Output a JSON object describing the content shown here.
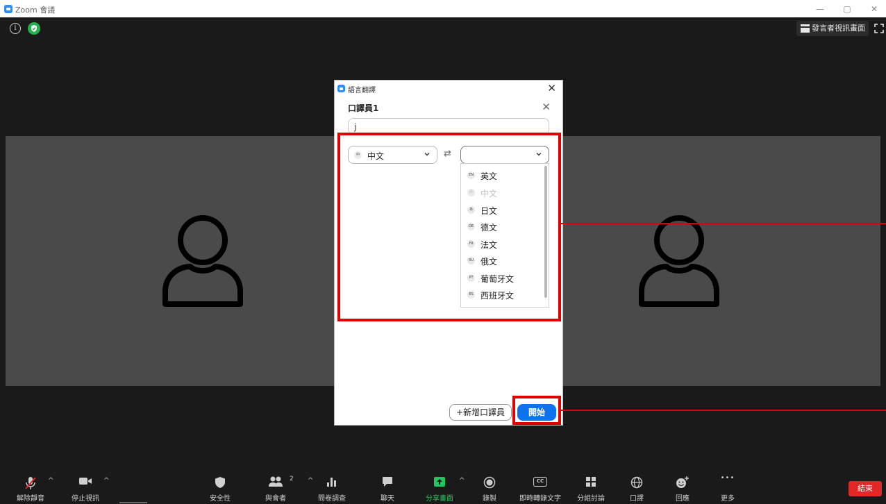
{
  "window": {
    "title": "Zoom 會議",
    "minimize": "—",
    "maximize": "▢",
    "close": "✕"
  },
  "top_bar": {
    "speaker_view_label": "發言者視訊畫面"
  },
  "dialog": {
    "title": "語言翻譯",
    "close": "✕",
    "interpreter_name": "口譯員1",
    "interpreter_close": "✕",
    "name_input_value": "j",
    "from_language": {
      "badge": "中",
      "label": "中文"
    },
    "swap_symbol": "⇄",
    "to_language": {
      "label": ""
    },
    "language_options": [
      {
        "badge": "EN",
        "label": "英文",
        "disabled": false
      },
      {
        "badge": "中",
        "label": "中文",
        "disabled": true
      },
      {
        "badge": "あ",
        "label": "日文",
        "disabled": false
      },
      {
        "badge": "DE",
        "label": "德文",
        "disabled": false
      },
      {
        "badge": "FR",
        "label": "法文",
        "disabled": false
      },
      {
        "badge": "RU",
        "label": "俄文",
        "disabled": false
      },
      {
        "badge": "PT",
        "label": "葡萄牙文",
        "disabled": false
      },
      {
        "badge": "ES",
        "label": "西班牙文",
        "disabled": false
      }
    ],
    "add_interpreter_label": "+新增口譯員",
    "start_label": "開始"
  },
  "toolbar": {
    "unmute": "解除靜音",
    "stop_video": "停止視訊",
    "security": "安全性",
    "participants": "與會者",
    "participants_count": "2",
    "polls": "問卷調查",
    "chat": "聊天",
    "share_screen": "分享畫面",
    "record": "錄製",
    "live_transcript": "即時轉錄文字",
    "breakout_rooms": "分組討論",
    "interpretation": "口譯",
    "reactions": "回應",
    "more": "更多",
    "end": "結束",
    "caret": "^",
    "cc": "CC",
    "more_dots": "•••"
  },
  "colors": {
    "background": "#1a1a1a",
    "tile": "#4a4a4a",
    "accent_blue": "#0e72ed",
    "highlight_red": "#e00000",
    "end_red": "#e02828",
    "share_green": "#22c55e"
  }
}
